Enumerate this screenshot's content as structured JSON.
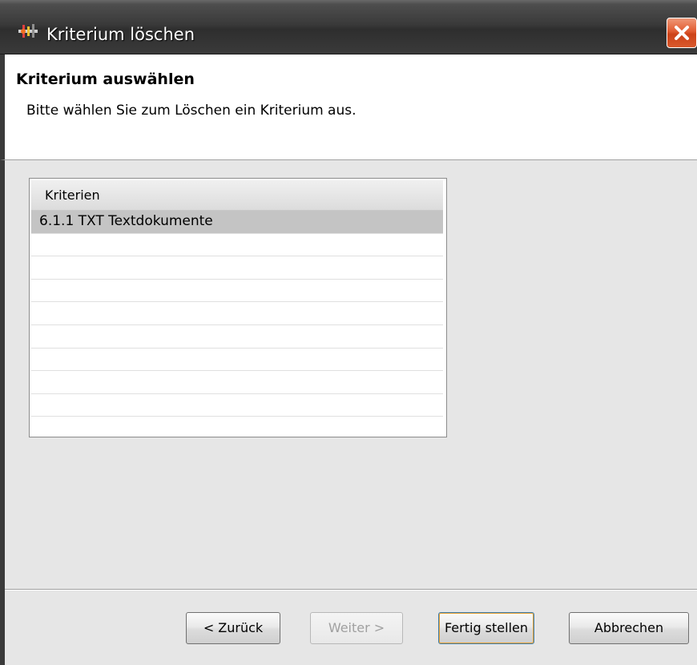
{
  "window": {
    "title": "Kriterium löschen",
    "icon": "app-icon",
    "close_icon": "close-icon",
    "close_color": "#d8582c"
  },
  "header": {
    "heading": "Kriterium auswählen",
    "description": "Bitte wählen Sie zum Löschen ein Kriterium aus."
  },
  "table": {
    "column_header": "Kriterien",
    "rows": [
      {
        "label": "6.1.1 TXT Textdokumente",
        "selected": true
      }
    ]
  },
  "buttons": {
    "back": {
      "label": "< Zurück",
      "enabled": true
    },
    "next": {
      "label": "Weiter >",
      "enabled": false
    },
    "finish": {
      "label": "Fertig stellen",
      "enabled": true,
      "focused": true
    },
    "cancel": {
      "label": "Abbrechen",
      "enabled": true
    }
  }
}
